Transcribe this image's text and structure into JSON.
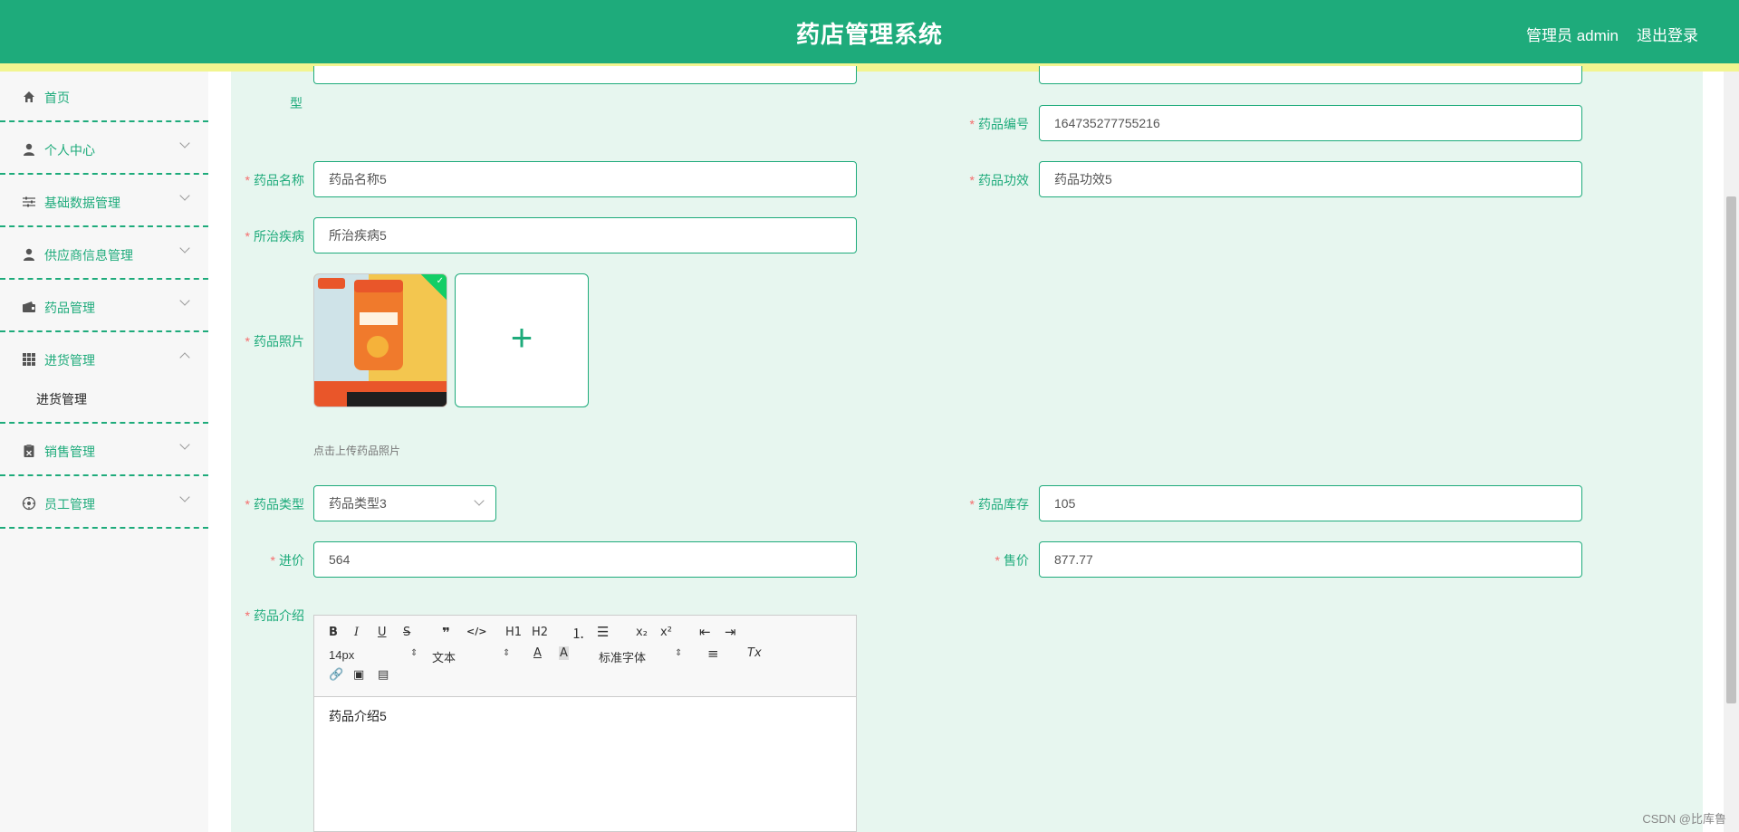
{
  "header": {
    "title": "药店管理系统",
    "admin_label": "管理员 admin",
    "logout_label": "退出登录"
  },
  "sidebar": {
    "items": [
      {
        "label": "首页",
        "icon": "home-icon",
        "expandable": false
      },
      {
        "label": "个人中心",
        "icon": "user-icon",
        "expandable": true
      },
      {
        "label": "基础数据管理",
        "icon": "sliders-icon",
        "expandable": true
      },
      {
        "label": "供应商信息管理",
        "icon": "user-icon",
        "expandable": true
      },
      {
        "label": "药品管理",
        "icon": "wallet-icon",
        "expandable": true
      },
      {
        "label": "进货管理",
        "icon": "grid-icon",
        "expandable": true,
        "expanded": true
      },
      {
        "label": "销售管理",
        "icon": "clipboard-icon",
        "expandable": true
      },
      {
        "label": "员工管理",
        "icon": "compass-icon",
        "expandable": true
      }
    ],
    "submenu": {
      "label": "进货管理"
    }
  },
  "form": {
    "partial_label_char": "型",
    "code": {
      "label": "药品编号",
      "value": "164735277755216"
    },
    "name": {
      "label": "药品名称",
      "value": "药品名称5"
    },
    "effect": {
      "label": "药品功效",
      "value": "药品功效5"
    },
    "disease": {
      "label": "所治疾病",
      "value": "所治疾病5"
    },
    "photo": {
      "label": "药品照片",
      "tip": "点击上传药品照片",
      "upload_symbol": "+"
    },
    "type": {
      "label": "药品类型",
      "value": "药品类型3"
    },
    "stock": {
      "label": "药品库存",
      "value": "105"
    },
    "purchase_price": {
      "label": "进价",
      "value": "564"
    },
    "sale_price": {
      "label": "售价",
      "value": "877.77"
    },
    "intro": {
      "label": "药品介绍",
      "content": "药品介绍5"
    }
  },
  "editor_toolbar": {
    "font_size": "14px",
    "text_format": "文本",
    "font_family": "标准字体",
    "heading1": "H1",
    "heading2": "H2",
    "subscript": "x₂",
    "superscript": "x²"
  },
  "watermark": "CSDN @比库鲁"
}
